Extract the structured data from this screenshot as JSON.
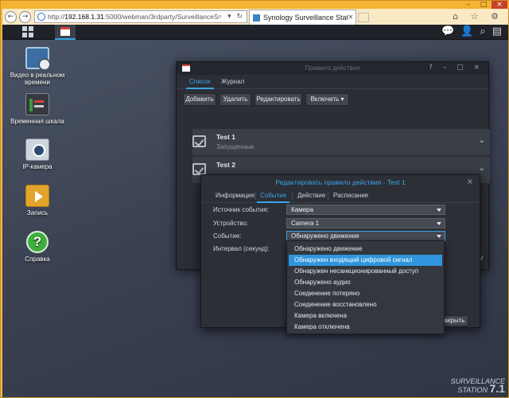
{
  "browser": {
    "url_prefix": "http://",
    "url_host": "192.168.1.31",
    "url_path": ":5000/webman/3rdparty/SurveillanceStation/",
    "tab_title": "Synology Surveillance Statio...",
    "back": "←",
    "forward": "→",
    "tab_close": "×",
    "addr_icons": "⌕ ▾ ↻",
    "tools": "⌂ ☆ ⚙",
    "win_min": "–",
    "win_max": "□",
    "win_close": "×"
  },
  "dsm": {
    "top_icons": [
      "💬",
      "👤",
      "⌕",
      "▤"
    ]
  },
  "desktop": [
    {
      "label": "Видео в реальном времени"
    },
    {
      "label": "Временная шкала"
    },
    {
      "label": "IP-камера"
    },
    {
      "label": "Запись"
    },
    {
      "label": "Справка",
      "glyph": "?"
    }
  ],
  "rule_window": {
    "title": "Правило действия",
    "controls": "? – □ ×",
    "tabs": [
      "Список",
      "Журнал"
    ],
    "toolbar": [
      "Добавить",
      "Удалить",
      "Редактировать",
      "Включить ▾"
    ],
    "rules": [
      {
        "name": "Test 1",
        "status": "Запущенные"
      },
      {
        "name": "Test 2",
        "status": ""
      }
    ],
    "chevron": "⌄",
    "refresh": "↻"
  },
  "edit_dialog": {
    "title": "Редактировать правило действия - Test 1",
    "close": "×",
    "tabs": [
      "Информация",
      "Событие",
      "Действие",
      "Расписание"
    ],
    "fields": [
      {
        "label": "Источник события:",
        "value": "Камера"
      },
      {
        "label": "Устройство:",
        "value": "Camera 1"
      },
      {
        "label": "Событие:",
        "value": "Обнаружено движение"
      },
      {
        "label": "Интервал (секунд):",
        "value": ""
      }
    ],
    "close_button": "Закрыть"
  },
  "dropdown": {
    "items": [
      "Обнаружено движение",
      "Обнаружен входящий цифровой сигнал",
      "Обнаружен несанкционированный доступ",
      "Обнаружено аудио",
      "Соединение потеряно",
      "Соединение восстановлено",
      "Камера включена",
      "Камера отключена"
    ],
    "highlighted_index": 1
  },
  "branding": {
    "line1": "SURVEILLANCE",
    "line2": "STATION",
    "version": "7.1"
  },
  "colors": {
    "accent": "#3ba5e8",
    "highlight": "#2f95dc",
    "window_bg": "#2b2e35"
  }
}
